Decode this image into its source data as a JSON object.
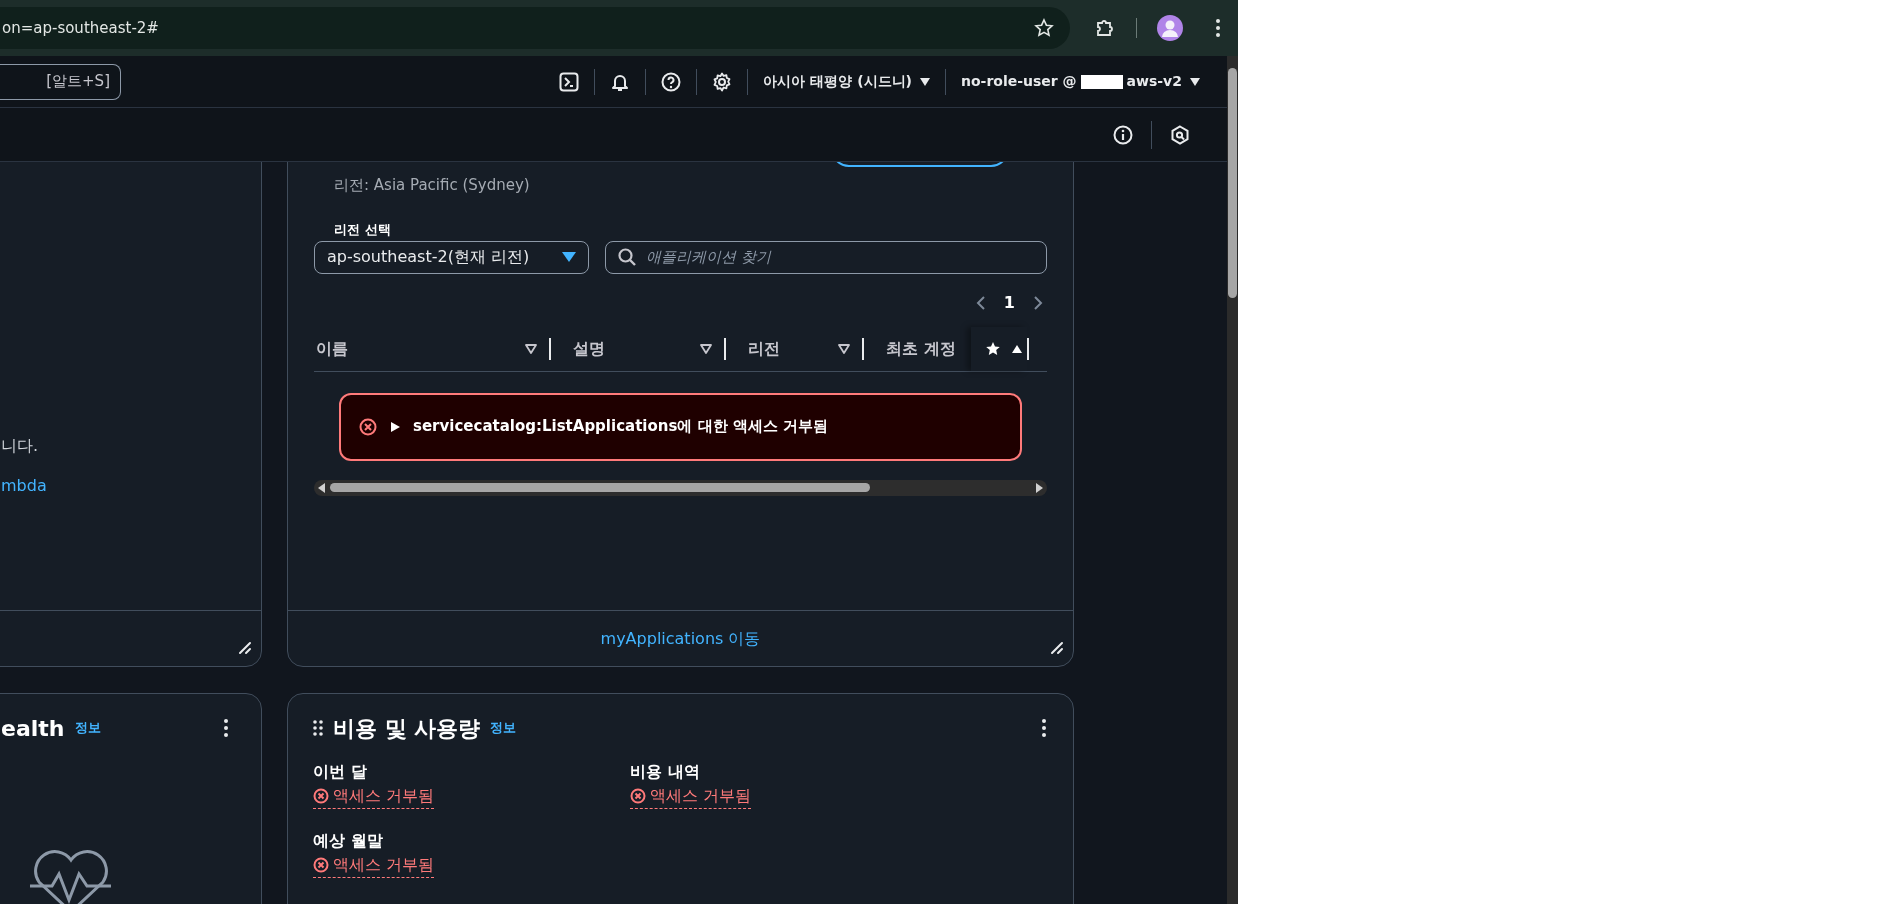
{
  "browser": {
    "url": "on=ap-southeast-2#"
  },
  "top_nav": {
    "search_shortcut": "[알트+S]",
    "region": "아시아 태평양 (시드니)",
    "user": "no-role-user @",
    "account": "aws-v2"
  },
  "left_widget": {
    "text": "니다.",
    "link": "mbda"
  },
  "applications_widget": {
    "region_text": "리전: Asia Pacific (Sydney)",
    "region_select": {
      "label": "리전 선택",
      "value": "ap-southeast-2(현재 리전)"
    },
    "search": {
      "placeholder": "애플리케이션 찾기"
    },
    "pages": [
      {
        "label": "1",
        "selected": true
      }
    ],
    "columns": [
      {
        "label": "이름",
        "sorted": false
      },
      {
        "label": "설명",
        "sorted": false
      },
      {
        "label": "리전",
        "sorted": false
      },
      {
        "label": "최초 계정"
      },
      {
        "sorted": true
      }
    ],
    "error": {
      "message": "servicecatalog:ListApplications에 대한 액세스 거부됨",
      "expanded": false
    },
    "footer_link": "myApplications 이동"
  },
  "health_widget": {
    "title": "ealth",
    "info": "정보"
  },
  "cost_widget": {
    "title": "비용 및 사용량",
    "info": "정보",
    "metrics": [
      {
        "label": "이번 달",
        "value": "액세스 거부됨"
      },
      {
        "label": "비용 내역",
        "value": "액세스 거부됨"
      },
      {
        "label": "예상 월말",
        "value": "액세스 거부됨"
      }
    ]
  }
}
